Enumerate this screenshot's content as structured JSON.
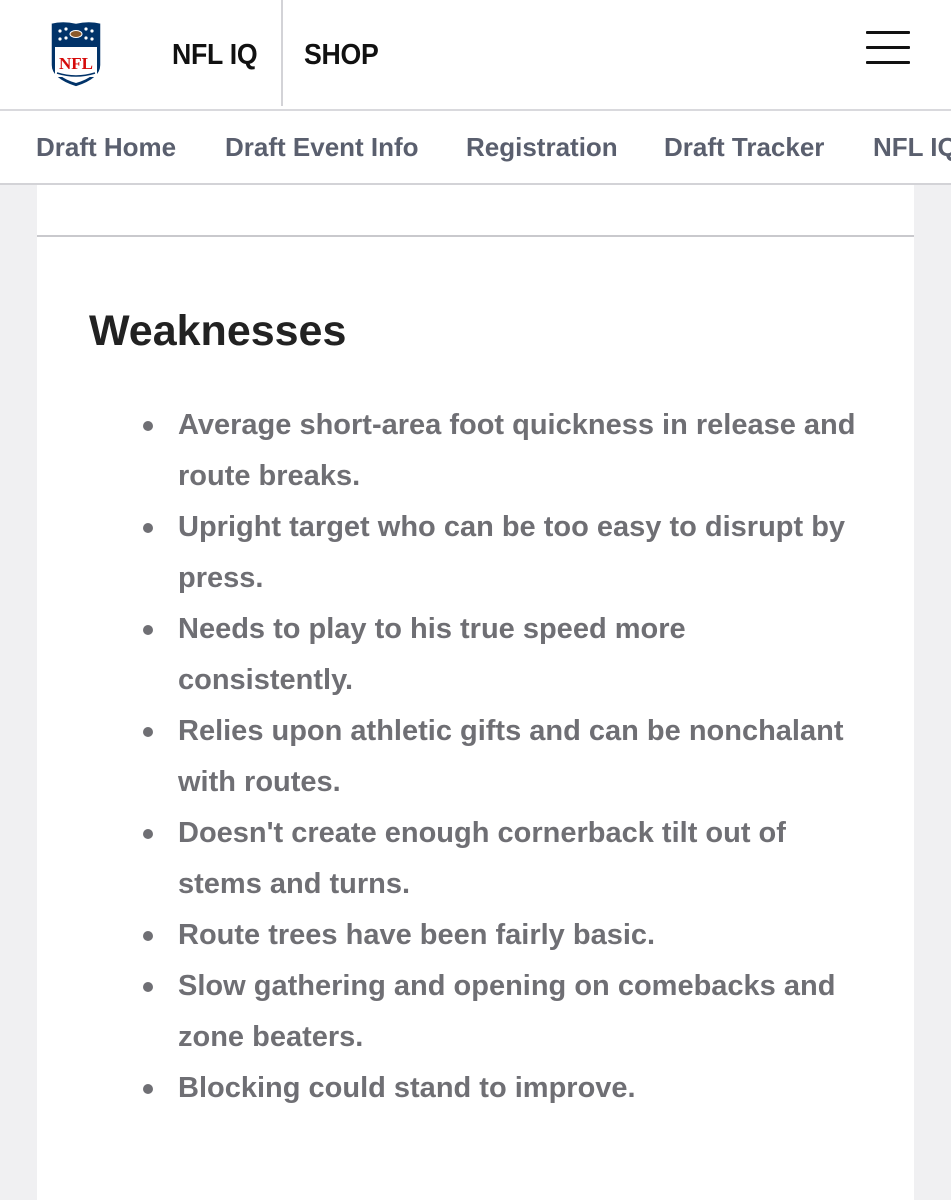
{
  "header": {
    "logo_text": "NFL",
    "nav": [
      {
        "label": "NFL IQ"
      },
      {
        "label": "SHOP"
      }
    ]
  },
  "sub_nav": {
    "items": [
      {
        "label": "Draft Home"
      },
      {
        "label": "Draft Event Info"
      },
      {
        "label": "Registration"
      },
      {
        "label": "Draft Tracker"
      },
      {
        "label": "NFL IQ"
      }
    ]
  },
  "content": {
    "section_title": "Weaknesses",
    "bullets": [
      "Average short-area foot quickness in release and route breaks.",
      "Upright target who can be too easy to disrupt by press.",
      "Needs to play to his true speed more consistently.",
      "Relies upon athletic gifts and can be nonchalant with routes.",
      "Doesn't create enough cornerback tilt out of stems and turns.",
      "Route trees have been fairly basic.",
      "Slow gathering and opening on comebacks and zone beaters.",
      "Blocking could stand to improve."
    ]
  },
  "colors": {
    "nfl_blue": "#013369",
    "nfl_red": "#d50a0a",
    "sub_nav_text": "#5a5f6e",
    "body_text": "#6f6f74",
    "title_text": "#222222"
  },
  "icons": [
    "nfl-shield-logo",
    "hamburger-menu-icon"
  ]
}
